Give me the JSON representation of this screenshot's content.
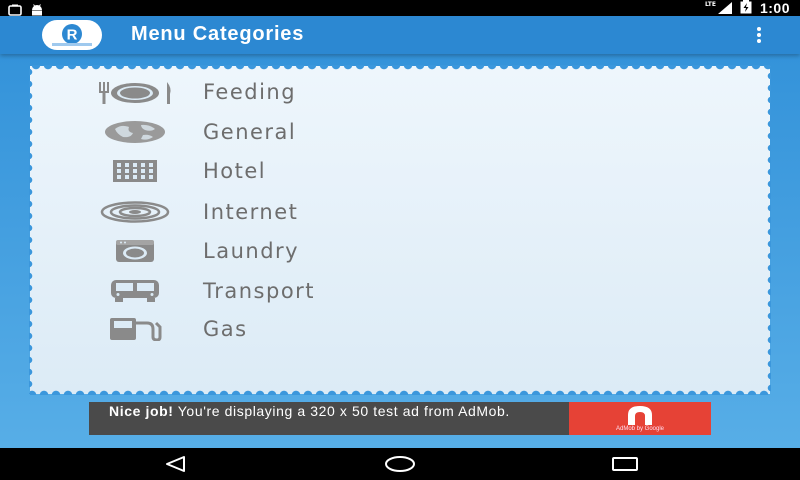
{
  "status_bar": {
    "time": "1:00",
    "network": "LTE",
    "icons": [
      "notification-icon",
      "android-icon",
      "lte-signal-icon",
      "signal-icon",
      "battery-charging-icon"
    ]
  },
  "app_bar": {
    "title": "Menu Categories",
    "logo_icon": "app-logo-icon",
    "menu_icon": "overflow-menu-icon"
  },
  "categories": [
    {
      "label": "Feeding",
      "icon": "plate-cutlery-icon"
    },
    {
      "label": "General",
      "icon": "globe-icon"
    },
    {
      "label": "Hotel",
      "icon": "building-icon"
    },
    {
      "label": "Internet",
      "icon": "wifi-signal-icon"
    },
    {
      "label": "Laundry",
      "icon": "washing-machine-icon"
    },
    {
      "label": "Transport",
      "icon": "bus-icon"
    },
    {
      "label": "Gas",
      "icon": "gas-pump-icon"
    }
  ],
  "ad": {
    "headline": "Nice job!",
    "body": "You're displaying a 320 x 50 test ad from AdMob.",
    "brand_caption": "AdMob by Google"
  },
  "colors": {
    "app_bar": "#2c88d2",
    "background": "#3b97dc",
    "card": "#e6f1fa",
    "label_text": "#6d6d6d",
    "icon_gray": "#8a8a8a",
    "ad_background": "#4a4a4a",
    "admob_red": "#e64236"
  }
}
